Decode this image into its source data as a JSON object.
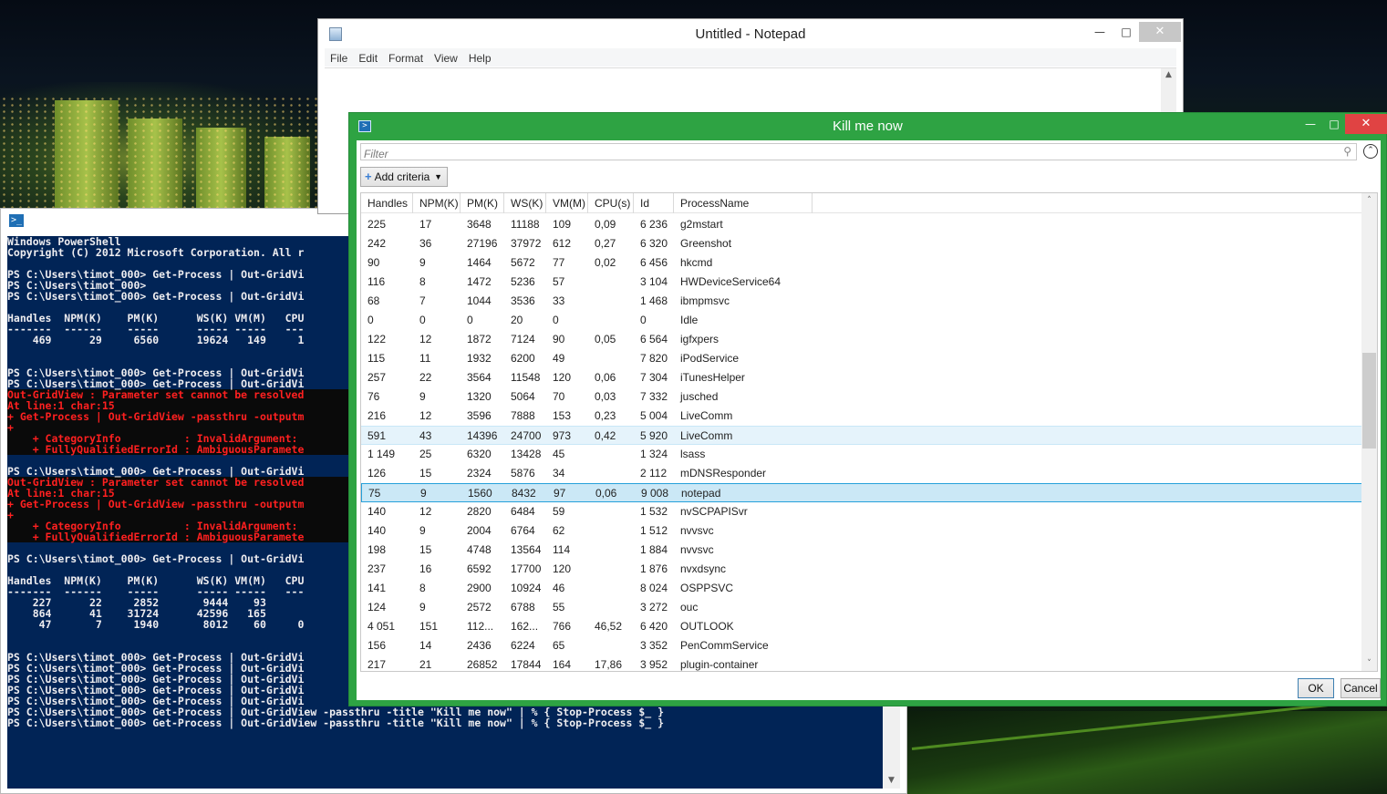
{
  "notepad": {
    "title": "Untitled - Notepad",
    "menu": [
      "File",
      "Edit",
      "Format",
      "View",
      "Help"
    ]
  },
  "powershell": {
    "lines": [
      {
        "t": "Windows PowerShell",
        "k": "n"
      },
      {
        "t": "Copyright (C) 2012 Microsoft Corporation. All r",
        "k": "n"
      },
      {
        "t": "",
        "k": "b"
      },
      {
        "t": "PS C:\\Users\\timot_000> Get-Process | Out-GridVi",
        "k": "n"
      },
      {
        "t": "PS C:\\Users\\timot_000>",
        "k": "n"
      },
      {
        "t": "PS C:\\Users\\timot_000> Get-Process | Out-GridVi",
        "k": "n"
      },
      {
        "t": "",
        "k": "b"
      },
      {
        "t": "Handles  NPM(K)    PM(K)      WS(K) VM(M)   CPU",
        "k": "n"
      },
      {
        "t": "-------  ------    -----      ----- -----   ---",
        "k": "n"
      },
      {
        "t": "    469      29     6560      19624   149     1",
        "k": "n"
      },
      {
        "t": "",
        "k": "b"
      },
      {
        "t": "",
        "k": "b"
      },
      {
        "t": "PS C:\\Users\\timot_000> Get-Process | Out-GridVi",
        "k": "n"
      },
      {
        "t": "PS C:\\Users\\timot_000> Get-Process | Out-GridVi",
        "k": "n"
      },
      {
        "t": "Out-GridView : Parameter set cannot be resolved",
        "k": "e"
      },
      {
        "t": "At line:1 char:15",
        "k": "e"
      },
      {
        "t": "+ Get-Process | Out-GridView -passthru -outputm",
        "k": "e"
      },
      {
        "t": "+",
        "k": "e"
      },
      {
        "t": "    + CategoryInfo          : InvalidArgument: ",
        "k": "e"
      },
      {
        "t": "    + FullyQualifiedErrorId : AmbiguousParamete",
        "k": "e"
      },
      {
        "t": "",
        "k": "b"
      },
      {
        "t": "PS C:\\Users\\timot_000> Get-Process | Out-GridVi",
        "k": "n"
      },
      {
        "t": "Out-GridView : Parameter set cannot be resolved",
        "k": "e"
      },
      {
        "t": "At line:1 char:15",
        "k": "e"
      },
      {
        "t": "+ Get-Process | Out-GridView -passthru -outputm",
        "k": "e"
      },
      {
        "t": "+",
        "k": "e"
      },
      {
        "t": "    + CategoryInfo          : InvalidArgument: ",
        "k": "e"
      },
      {
        "t": "    + FullyQualifiedErrorId : AmbiguousParamete",
        "k": "e"
      },
      {
        "t": "",
        "k": "b"
      },
      {
        "t": "PS C:\\Users\\timot_000> Get-Process | Out-GridVi",
        "k": "n"
      },
      {
        "t": "",
        "k": "b"
      },
      {
        "t": "Handles  NPM(K)    PM(K)      WS(K) VM(M)   CPU",
        "k": "n"
      },
      {
        "t": "-------  ------    -----      ----- -----   ---",
        "k": "n"
      },
      {
        "t": "    227      22     2852       9444    93",
        "k": "n"
      },
      {
        "t": "    864      41    31724      42596   165",
        "k": "n"
      },
      {
        "t": "     47       7     1940       8012    60     0",
        "k": "n"
      },
      {
        "t": "",
        "k": "b"
      },
      {
        "t": "",
        "k": "b"
      },
      {
        "t": "PS C:\\Users\\timot_000> Get-Process | Out-GridVi",
        "k": "n"
      },
      {
        "t": "PS C:\\Users\\timot_000> Get-Process | Out-GridVi",
        "k": "n"
      },
      {
        "t": "PS C:\\Users\\timot_000> Get-Process | Out-GridVi",
        "k": "n"
      },
      {
        "t": "PS C:\\Users\\timot_000> Get-Process | Out-GridVi",
        "k": "n"
      },
      {
        "t": "PS C:\\Users\\timot_000> Get-Process | Out-GridVi",
        "k": "n"
      },
      {
        "t": "PS C:\\Users\\timot_000> Get-Process | Out-GridView -passthru -title \"Kill me now\" | % { Stop-Process $_ }",
        "k": "n"
      },
      {
        "t": "PS C:\\Users\\timot_000> Get-Process | Out-GridView -passthru -title \"Kill me now\" | % { Stop-Process $_ }",
        "k": "n"
      }
    ]
  },
  "gridview": {
    "title": "Kill me now",
    "filter_placeholder": "Filter",
    "add_criteria_label": "Add criteria",
    "ok_label": "OK",
    "cancel_label": "Cancel",
    "columns": [
      "Handles",
      "NPM(K)",
      "PM(K)",
      "WS(K)",
      "VM(M)",
      "CPU(s)",
      "Id",
      "ProcessName"
    ],
    "rows": [
      [
        "225",
        "17",
        "3648",
        "11188",
        "109",
        "0,09",
        "6 236",
        "g2mstart"
      ],
      [
        "242",
        "36",
        "27196",
        "37972",
        "612",
        "0,27",
        "6 320",
        "Greenshot"
      ],
      [
        "90",
        "9",
        "1464",
        "5672",
        "77",
        "0,02",
        "6 456",
        "hkcmd"
      ],
      [
        "116",
        "8",
        "1472",
        "5236",
        "57",
        "",
        "3 104",
        "HWDeviceService64"
      ],
      [
        "68",
        "7",
        "1044",
        "3536",
        "33",
        "",
        "1 468",
        "ibmpmsvc"
      ],
      [
        "0",
        "0",
        "0",
        "20",
        "0",
        "",
        "0",
        "Idle"
      ],
      [
        "122",
        "12",
        "1872",
        "7124",
        "90",
        "0,05",
        "6 564",
        "igfxpers"
      ],
      [
        "115",
        "11",
        "1932",
        "6200",
        "49",
        "",
        "7 820",
        "iPodService"
      ],
      [
        "257",
        "22",
        "3564",
        "11548",
        "120",
        "0,06",
        "7 304",
        "iTunesHelper"
      ],
      [
        "76",
        "9",
        "1320",
        "5064",
        "70",
        "0,03",
        "7 332",
        "jusched"
      ],
      [
        "216",
        "12",
        "3596",
        "7888",
        "153",
        "0,23",
        "5 004",
        "LiveComm"
      ],
      [
        "591",
        "43",
        "14396",
        "24700",
        "973",
        "0,42",
        "5 920",
        "LiveComm"
      ],
      [
        "1 149",
        "25",
        "6320",
        "13428",
        "45",
        "",
        "1 324",
        "lsass"
      ],
      [
        "126",
        "15",
        "2324",
        "5876",
        "34",
        "",
        "2 112",
        "mDNSResponder"
      ],
      [
        "75",
        "9",
        "1560",
        "8432",
        "97",
        "0,06",
        "9 008",
        "notepad"
      ],
      [
        "140",
        "12",
        "2820",
        "6484",
        "59",
        "",
        "1 532",
        "nvSCPAPISvr"
      ],
      [
        "140",
        "9",
        "2004",
        "6764",
        "62",
        "",
        "1 512",
        "nvvsvc"
      ],
      [
        "198",
        "15",
        "4748",
        "13564",
        "114",
        "",
        "1 884",
        "nvvsvc"
      ],
      [
        "237",
        "16",
        "6592",
        "17700",
        "120",
        "",
        "1 876",
        "nvxdsync"
      ],
      [
        "141",
        "8",
        "2900",
        "10924",
        "46",
        "",
        "8 024",
        "OSPPSVC"
      ],
      [
        "124",
        "9",
        "2572",
        "6788",
        "55",
        "",
        "3 272",
        "ouc"
      ],
      [
        "4 051",
        "151",
        "112...",
        "162...",
        "766",
        "46,52",
        "6 420",
        "OUTLOOK"
      ],
      [
        "156",
        "14",
        "2436",
        "6224",
        "65",
        "",
        "3 352",
        "PenCommService"
      ],
      [
        "217",
        "21",
        "26852",
        "17844",
        "164",
        "17,86",
        "3 952",
        "plugin-container"
      ]
    ],
    "hover_row_index": 11,
    "selected_row_index": 14
  },
  "colors": {
    "ps_background": "#012456",
    "ps_error": "#ff2020",
    "gridview_frame": "#2ea343",
    "selection": "#cbe8f6"
  }
}
